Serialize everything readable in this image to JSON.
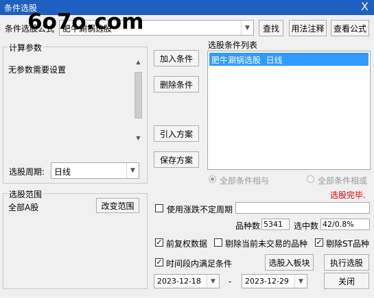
{
  "window": {
    "title": "条件选股",
    "close_glyph": "X"
  },
  "watermark": "6o7o.com",
  "top": {
    "label": "条件选股公式",
    "formula_value": "肥牛涮锅选股",
    "find_button": "查找",
    "usage_button": "用法注释",
    "view_formula_button": "查看公式"
  },
  "params": {
    "group_label": "计算参数",
    "none_text": "无参数需要设置",
    "period_label": "选股周期:",
    "period_value": "日线"
  },
  "actions": {
    "add_condition": "加入条件",
    "delete_condition": "删除条件",
    "import_plan": "引入方案",
    "save_plan": "保存方案"
  },
  "conditions": {
    "list_label": "选股条件列表",
    "items": [
      "肥牛涮锅选股  日线"
    ],
    "and_label": "全部条件相与",
    "or_label": "全部条件相或"
  },
  "status": {
    "text": "选股完毕.",
    "color": "#e00000"
  },
  "scope": {
    "group_label": "选股范围",
    "value": "全部A股",
    "change_button": "改变范围"
  },
  "options": {
    "variable_period_label": "使用涨跌不定周期",
    "variable_period_checked": false,
    "stock_count_label": "品种数",
    "stock_count_value": "5341",
    "selected_count_label": "选中数",
    "selected_count_value": "42/0.8%",
    "pre_adjust_label": "前复权数据",
    "pre_adjust_checked": true,
    "exclude_untraded_label": "剔除当前未交易的品种",
    "exclude_untraded_checked": false,
    "exclude_st_label": "剔除ST品种",
    "exclude_st_checked": true,
    "time_range_label": "时间段内满足条件",
    "time_range_checked": true
  },
  "dates": {
    "start": "2023-12-18",
    "separator": "-",
    "end": "2023-12-29"
  },
  "bottom": {
    "to_block_button": "选股入板块",
    "run_button": "执行选股",
    "close_button": "关闭"
  }
}
